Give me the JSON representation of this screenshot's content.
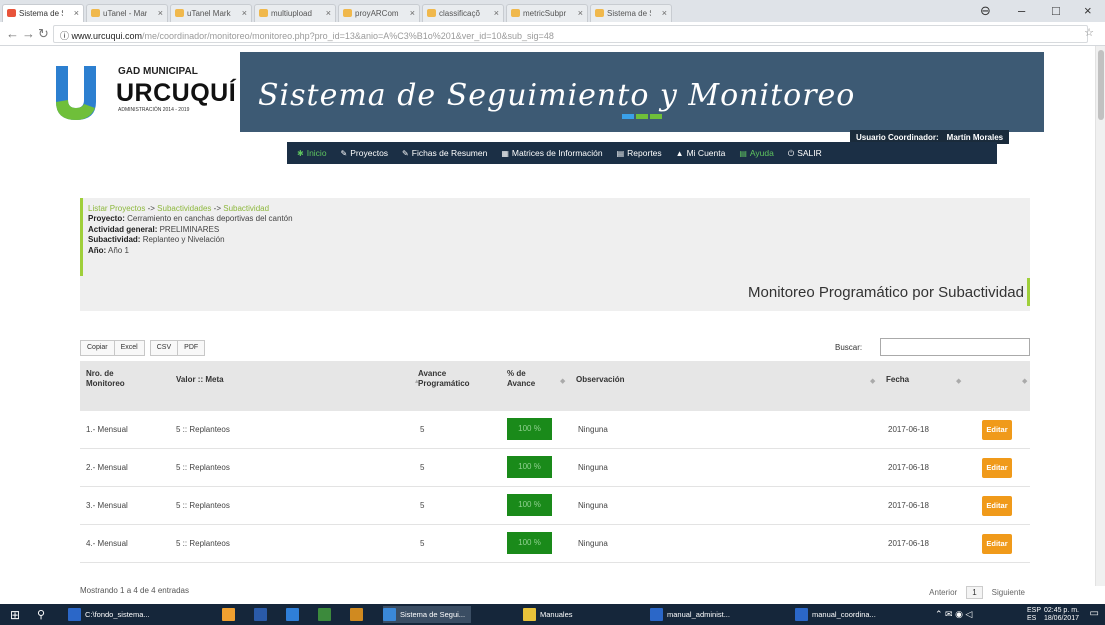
{
  "browser": {
    "tabs": [
      {
        "label": "Sistema de Se"
      },
      {
        "label": "uTanel - Marc"
      },
      {
        "label": "uTanel Mark"
      },
      {
        "label": "multiupload"
      },
      {
        "label": "proyARCom"
      },
      {
        "label": "classificaçõ"
      },
      {
        "label": "metricSubpr"
      },
      {
        "label": "Sistema de Se"
      }
    ],
    "url_host": "www.urcuqui.com",
    "url_path": "/me/coordinador/monitoreo/monitoreo.php?pro_id=13&anio=A%C3%B1o%201&ver_id=10&sub_sig=48"
  },
  "site": {
    "logo_top": "GAD MUNICIPAL",
    "logo_name": "URCUQUÍ",
    "logo_sub": "ADMINISTRACIÓN 2014 - 2019",
    "title": "Sistema de Seguimiento y Monitoreo",
    "user_role": "Usuario Coordinador:",
    "user_name": "Martín Morales",
    "nav": [
      {
        "icon": "home-icon",
        "glyph": "✱",
        "label": "Inicio"
      },
      {
        "icon": "pencil-icon",
        "glyph": "✎",
        "label": "Proyectos"
      },
      {
        "icon": "pencil-icon",
        "glyph": "✎",
        "label": "Fichas de Resumen"
      },
      {
        "icon": "table-icon",
        "glyph": "▦",
        "label": "Matrices de Información"
      },
      {
        "icon": "document-icon",
        "glyph": "▤",
        "label": "Reportes"
      },
      {
        "icon": "user-icon",
        "glyph": "▲",
        "label": "Mi Cuenta"
      },
      {
        "icon": "book-icon",
        "glyph": "▤",
        "label": "Ayuda"
      },
      {
        "icon": "power-icon",
        "glyph": "⏻",
        "label": "SALIR"
      }
    ],
    "accent_green": "#8db83c",
    "header_blue": "#3d5a74",
    "nav_dark": "#1b2f45"
  },
  "breadcrumb": {
    "items": [
      "Listar Proyectos",
      "Subactividades",
      "Subactividad"
    ],
    "separator": "->"
  },
  "info": {
    "proyecto_label": "Proyecto:",
    "proyecto": "Cerramiento en canchas deportivas del cantón",
    "actividad_label": "Actividad general:",
    "actividad": "PRELIMINARES",
    "subactividad_label": "Subactividad:",
    "subactividad": "Replanteo y Nivelación",
    "anio_label": "Año:",
    "anio": "Año 1"
  },
  "page_heading": "Monitoreo Programático por Subactividad",
  "toolbar": {
    "buttons": [
      "Copiar",
      "Excel",
      "CSV",
      "PDF"
    ],
    "search_label": "Buscar:",
    "search_value": ""
  },
  "table": {
    "headers": {
      "nro": "Nro. de Monitoreo",
      "valor": "Valor :: Meta",
      "avance_prog": "Avance Programático",
      "pct": "% de Avance",
      "obs": "Observación",
      "fecha": "Fecha"
    },
    "rows": [
      {
        "nro": "1.- Mensual",
        "valor": "5 :: Replanteos",
        "avance": "5",
        "pct": "100 %",
        "obs": "Ninguna",
        "fecha": "2017-06-18",
        "action": "Editar"
      },
      {
        "nro": "2.- Mensual",
        "valor": "5 :: Replanteos",
        "avance": "5",
        "pct": "100 %",
        "obs": "Ninguna",
        "fecha": "2017-06-18",
        "action": "Editar"
      },
      {
        "nro": "3.- Mensual",
        "valor": "5 :: Replanteos",
        "avance": "5",
        "pct": "100 %",
        "obs": "Ninguna",
        "fecha": "2017-06-18",
        "action": "Editar"
      },
      {
        "nro": "4.- Mensual",
        "valor": "5 :: Replanteos",
        "avance": "5",
        "pct": "100 %",
        "obs": "Ninguna",
        "fecha": "2017-06-18",
        "action": "Editar"
      }
    ],
    "footer": "Mostrando 1 a 4 de 4 entradas",
    "prev": "Anterior",
    "page": "1",
    "next": "Siguiente",
    "pct_color": "#1a8a1a",
    "edit_color": "#f09a1a"
  },
  "taskbar": {
    "items": [
      {
        "label": "C:\\fondo_sistema...",
        "color": "#2b67c8"
      },
      {
        "label": "",
        "color": "#f0a030"
      },
      {
        "label": "",
        "color": "#2a5aa8"
      },
      {
        "label": "",
        "color": "#2f7fd8"
      },
      {
        "label": "",
        "color": "#3c8a3c"
      },
      {
        "label": "",
        "color": "#d08a20"
      },
      {
        "label": "Sistema de Segui...",
        "color": "#3a88d8"
      },
      {
        "label": "Manuales",
        "color": "#e8c23a"
      },
      {
        "label": "manual_administ...",
        "color": "#2b67c8"
      },
      {
        "label": "manual_coordina...",
        "color": "#2b67c8"
      }
    ],
    "lang": "ESP",
    "lang_sub": "ES",
    "time": "02:45 p. m.",
    "date": "18/06/2017"
  }
}
